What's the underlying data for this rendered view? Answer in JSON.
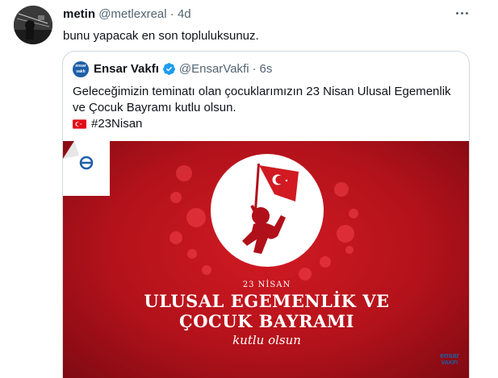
{
  "tweet": {
    "author_name": "metin",
    "author_handle": "@metlexreal",
    "separator": "·",
    "time": "4d",
    "text": "bunu yapacak en son topluluksunuz."
  },
  "quote": {
    "author_name": "Ensar Vakfı",
    "author_handle": "@EnsarVakfi",
    "separator": "·",
    "time": "6s",
    "avatar_text": "ensar",
    "avatar_subtext": "vakfı",
    "text": "Geleceğimizin teminatı olan çocuklarımızın 23 Nisan Ulusal Egemenlik ve Çocuk Bayramı kutlu olsun.",
    "hashtag": "#23Nisan",
    "media": {
      "small_title": "23 NİSAN",
      "line1": "ULUSAL EGEMENLİK VE",
      "line2": "ÇOCUK BAYRAMI",
      "script": "kutlu olsun",
      "logo_text": "ensar",
      "logo_subtext": "VAKFI"
    }
  },
  "icons": {
    "more": "more-options-icon",
    "verified": "verified-badge-icon",
    "flag": "turkey-flag-icon"
  },
  "colors": {
    "text_primary": "#0f1419",
    "text_secondary": "#536471",
    "verified_blue": "#1d9bf0",
    "media_red": "#c4161f"
  }
}
